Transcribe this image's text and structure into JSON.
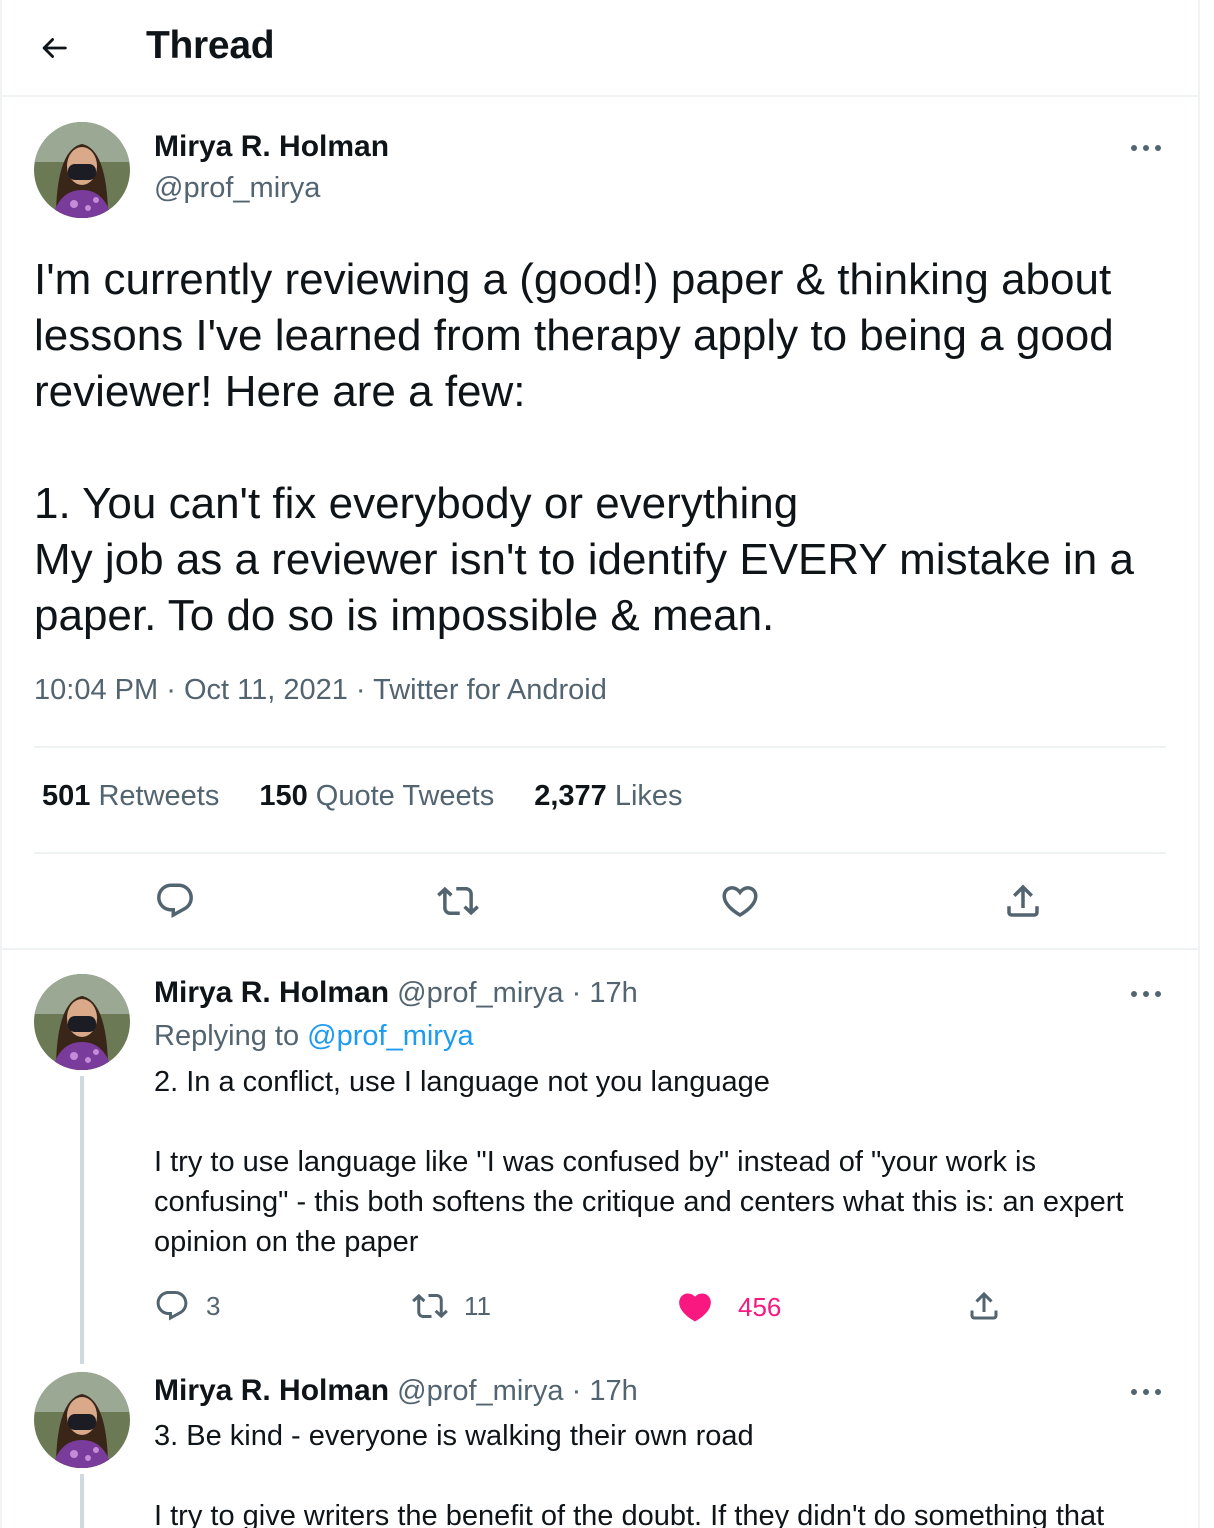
{
  "header": {
    "title": "Thread"
  },
  "author": {
    "name": "Mirya R. Holman",
    "handle": "@prof_mirya"
  },
  "main_tweet": {
    "text": "I'm currently reviewing a (good!) paper & thinking about lessons I've learned from therapy apply to being a good reviewer! Here are a few:\n\n1. You can't fix everybody or everything\nMy job as a reviewer isn't to identify EVERY mistake in a paper. To do so is impossible & mean.",
    "time": "10:04 PM",
    "date": "Oct 11, 2021",
    "source": "Twitter for Android",
    "separator": "·",
    "stats": [
      {
        "num": "501",
        "label": "Retweets"
      },
      {
        "num": "150",
        "label": "Quote Tweets"
      },
      {
        "num": "2,377",
        "label": "Likes"
      }
    ]
  },
  "replies": [
    {
      "name": "Mirya R. Holman",
      "handle": "@prof_mirya",
      "time": "· 17h",
      "replying_prefix": "Replying to",
      "replying_handle": "@prof_mirya",
      "text": "2. In a conflict, use I language not you language\n\nI try to use language like \"I was confused by\" instead of \"your work is confusing\" - this both softens the critique and centers what this is: an expert opinion on the paper",
      "replies_count": "3",
      "retweets_count": "11",
      "likes_count": "456",
      "liked": true
    },
    {
      "name": "Mirya R. Holman",
      "handle": "@prof_mirya",
      "time": "· 17h",
      "text": "3. Be kind - everyone is walking their own road\n\nI try to give writers the benefit of the doubt. If they didn't do something that"
    }
  ],
  "colors": {
    "accent": "#1d9bf0",
    "like": "#f91880",
    "secondary": "#536471",
    "border": "#eff3f4"
  },
  "icons": [
    "back-arrow-icon",
    "more-icon",
    "reply-icon",
    "retweet-icon",
    "like-icon",
    "share-icon"
  ]
}
